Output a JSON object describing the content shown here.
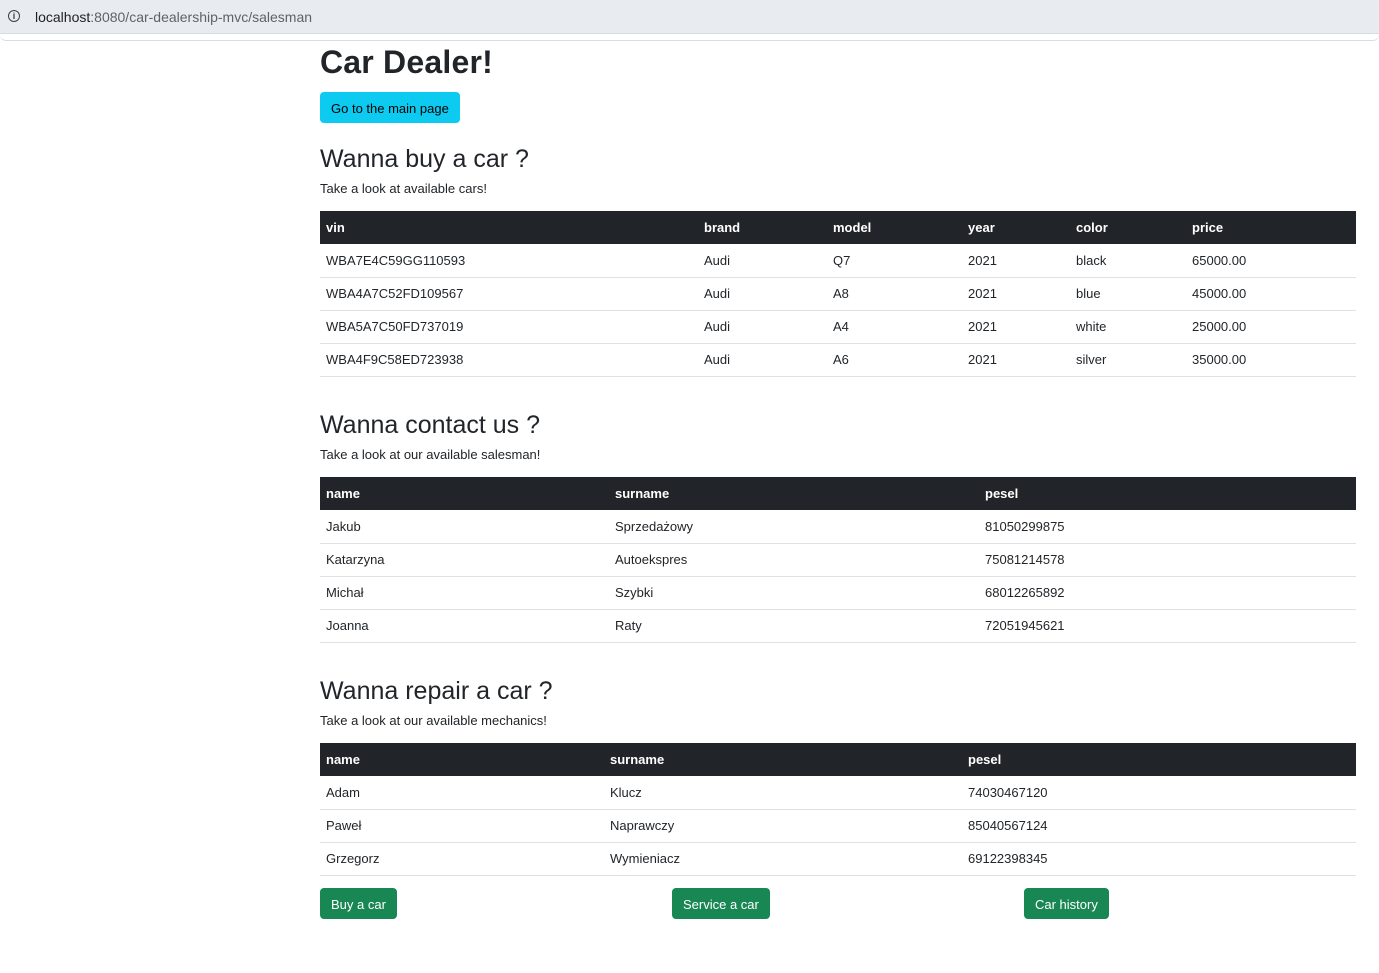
{
  "browser": {
    "url_host": "localhost",
    "url_path": ":8080/car-dealership-mvc/salesman"
  },
  "page": {
    "title": "Car Dealer!",
    "main_page_button": "Go to the main page"
  },
  "cars_section": {
    "heading": "Wanna buy a car ?",
    "subtitle": "Take a look at available cars!",
    "columns": [
      "vin",
      "brand",
      "model",
      "year",
      "color",
      "price"
    ],
    "rows": [
      [
        "WBA7E4C59GG110593",
        "Audi",
        "Q7",
        "2021",
        "black",
        "65000.00"
      ],
      [
        "WBA4A7C52FD109567",
        "Audi",
        "A8",
        "2021",
        "blue",
        "45000.00"
      ],
      [
        "WBA5A7C50FD737019",
        "Audi",
        "A4",
        "2021",
        "white",
        "25000.00"
      ],
      [
        "WBA4F9C58ED723938",
        "Audi",
        "A6",
        "2021",
        "silver",
        "35000.00"
      ]
    ]
  },
  "salesman_section": {
    "heading": "Wanna contact us ?",
    "subtitle": "Take a look at our available salesman!",
    "columns": [
      "name",
      "surname",
      "pesel"
    ],
    "rows": [
      [
        "Jakub",
        "Sprzedażowy",
        "81050299875"
      ],
      [
        "Katarzyna",
        "Autoekspres",
        "75081214578"
      ],
      [
        "Michał",
        "Szybki",
        "68012265892"
      ],
      [
        "Joanna",
        "Raty",
        "72051945621"
      ]
    ]
  },
  "mechanic_section": {
    "heading": "Wanna repair a car ?",
    "subtitle": "Take a look at our available mechanics!",
    "columns": [
      "name",
      "surname",
      "pesel"
    ],
    "rows": [
      [
        "Adam",
        "Klucz",
        "74030467120"
      ],
      [
        "Paweł",
        "Naprawczy",
        "85040567124"
      ],
      [
        "Grzegorz",
        "Wymieniacz",
        "69122398345"
      ]
    ]
  },
  "actions": {
    "buy": "Buy a car",
    "service": "Service a car",
    "history": "Car history"
  },
  "colors": {
    "info_button": "#0dcaf0",
    "success_button": "#198754",
    "table_header": "#212529"
  }
}
